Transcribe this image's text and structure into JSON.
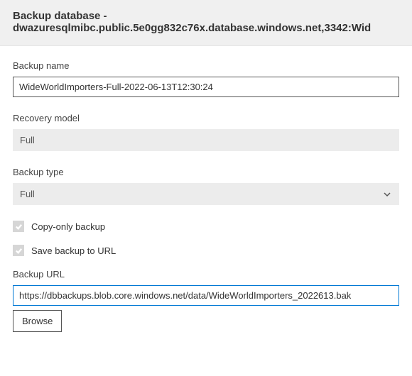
{
  "header": {
    "title_line1": "Backup database -",
    "title_line2": "dwazuresqlmibc.public.5e0gg832c76x.database.windows.net,3342:Wid"
  },
  "fields": {
    "backup_name": {
      "label": "Backup name",
      "value": "WideWorldImporters-Full-2022-06-13T12:30:24"
    },
    "recovery_model": {
      "label": "Recovery model",
      "value": "Full"
    },
    "backup_type": {
      "label": "Backup type",
      "value": "Full"
    },
    "copy_only": {
      "label": "Copy-only backup",
      "checked": true
    },
    "save_to_url": {
      "label": "Save backup to URL",
      "checked": true
    },
    "backup_url": {
      "label": "Backup URL",
      "value": "https://dbbackups.blob.core.windows.net/data/WideWorldImporters_2022613.bak"
    },
    "browse_button": "Browse"
  }
}
